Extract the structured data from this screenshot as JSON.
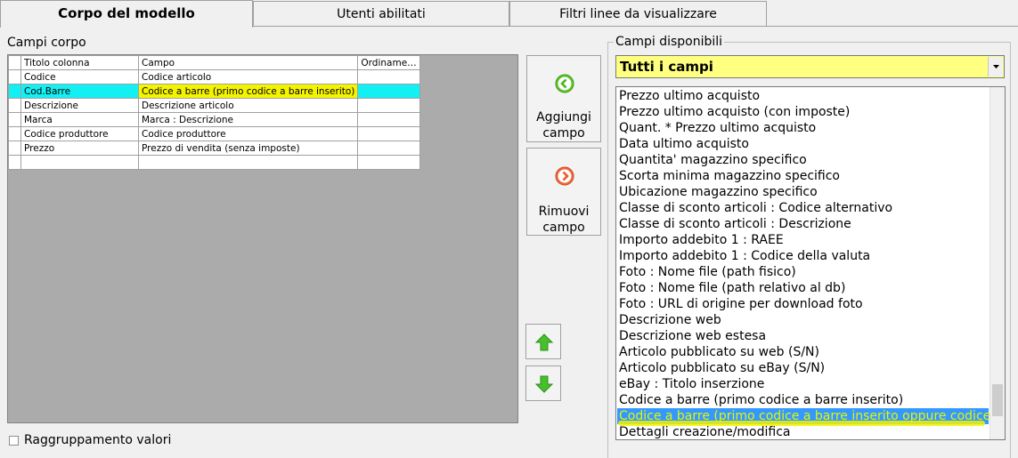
{
  "tabs": [
    "Corpo del modello",
    "Utenti abilitati",
    "Filtri linee da visualizzare"
  ],
  "left_panel": {
    "title": "Campi corpo",
    "columns": [
      "Titolo colonna",
      "Campo",
      "Ordiname…"
    ],
    "rows": [
      {
        "titolo": "Codice",
        "campo": "Codice articolo",
        "ord": ""
      },
      {
        "titolo": "Cod.Barre",
        "campo": "Codice a barre (primo codice a barre inserito)",
        "ord": ""
      },
      {
        "titolo": "Descrizione",
        "campo": "Descrizione articolo",
        "ord": ""
      },
      {
        "titolo": "Marca",
        "campo": "Marca : Descrizione",
        "ord": ""
      },
      {
        "titolo": "Codice produttore",
        "campo": "Codice produttore",
        "ord": ""
      },
      {
        "titolo": "Prezzo",
        "campo": "Prezzo di vendita (senza imposte)",
        "ord": ""
      },
      {
        "titolo": "",
        "campo": "",
        "ord": ""
      }
    ],
    "checkbox_label": "Raggruppamento valori"
  },
  "buttons": {
    "add_line1": "Aggiungi",
    "add_line2": "campo",
    "remove_line1": "Rimuovi",
    "remove_line2": "campo"
  },
  "right_panel": {
    "title": "Campi disponibili",
    "combo_value": "Tutti i campi",
    "items": [
      "Prezzo ultimo acquisto",
      "Prezzo ultimo acquisto (con imposte)",
      "Quant. * Prezzo ultimo acquisto",
      "Data ultimo acquisto",
      "Quantita' magazzino specifico",
      "Scorta minima magazzino specifico",
      "Ubicazione magazzino specifico",
      "Classe di sconto articoli : Codice alternativo",
      "Classe di sconto articoli : Descrizione",
      "Importo addebito 1 : RAEE",
      "Importo addebito 1 : Codice della valuta",
      "Foto : Nome file (path fisico)",
      "Foto : Nome file (path relativo al db)",
      "Foto : URL di origine per download foto",
      "Descrizione web",
      "Descrizione web estesa",
      "Articolo pubblicato su web (S/N)",
      "Articolo pubblicato su eBay (S/N)",
      "eBay : Titolo inserzione",
      "Codice a barre (primo codice a barre inserito)",
      "Codice a barre (primo codice a barre inserito oppure codice inter",
      "Dettagli creazione/modifica"
    ],
    "selected_index": 20
  },
  "colors": {
    "selected_row": "#13f0f3",
    "highlighter": "#f4f400",
    "combo_bg": "#ffff80",
    "list_selection": "#3399ff"
  }
}
